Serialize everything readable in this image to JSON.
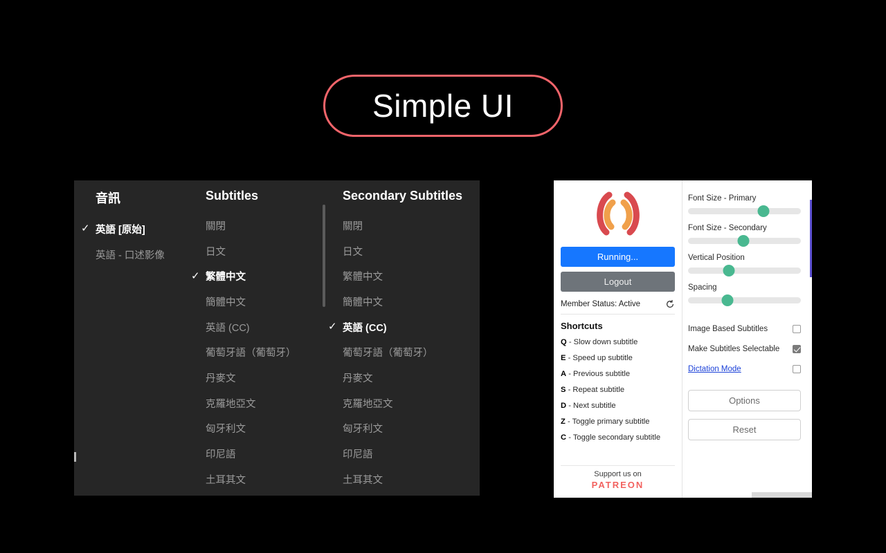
{
  "title_badge": {
    "text": "Simple UI",
    "border_color": "#f2646a"
  },
  "subtitle_panel": {
    "columns": [
      {
        "id": "audio",
        "header": "音訊",
        "options": [
          {
            "label": "英語 [原始]",
            "selected": true
          },
          {
            "label": "英語 - 口述影像",
            "selected": false
          }
        ]
      },
      {
        "id": "primary",
        "header": "Subtitles",
        "options": [
          {
            "label": "關閉",
            "selected": false
          },
          {
            "label": "日文",
            "selected": false
          },
          {
            "label": "繁體中文",
            "selected": true
          },
          {
            "label": "簡體中文",
            "selected": false
          },
          {
            "label": "英語 (CC)",
            "selected": false
          },
          {
            "label": "葡萄牙語（葡萄牙）",
            "selected": false
          },
          {
            "label": "丹麥文",
            "selected": false
          },
          {
            "label": "克羅地亞文",
            "selected": false
          },
          {
            "label": "匈牙利文",
            "selected": false
          },
          {
            "label": "印尼語",
            "selected": false
          },
          {
            "label": "土耳其文",
            "selected": false
          }
        ]
      },
      {
        "id": "secondary",
        "header": "Secondary Subtitles",
        "options": [
          {
            "label": "關閉",
            "selected": false
          },
          {
            "label": "日文",
            "selected": false
          },
          {
            "label": "繁體中文",
            "selected": false
          },
          {
            "label": "簡體中文",
            "selected": false
          },
          {
            "label": "英語 (CC)",
            "selected": true
          },
          {
            "label": "葡萄牙語（葡萄牙）",
            "selected": false
          },
          {
            "label": "丹麥文",
            "selected": false
          },
          {
            "label": "克羅地亞文",
            "selected": false
          },
          {
            "label": "匈牙利文",
            "selected": false
          },
          {
            "label": "印尼語",
            "selected": false
          },
          {
            "label": "土耳其文",
            "selected": false
          }
        ]
      }
    ],
    "check_glyph": "✓"
  },
  "extension_panel": {
    "logo": {
      "name": "language-reactor-brackets-logo",
      "outer_color": "#d94a4f",
      "inner_color": "#f0a04b"
    },
    "run_button": "Running...",
    "logout_button": "Logout",
    "member_status": "Member Status: Active",
    "refresh_icon": "refresh-icon",
    "shortcuts_title": "Shortcuts",
    "shortcuts": [
      {
        "key": "Q",
        "action": "- Slow down subtitle"
      },
      {
        "key": "E",
        "action": "- Speed up subtitle"
      },
      {
        "key": "A",
        "action": "- Previous subtitle"
      },
      {
        "key": "S",
        "action": "- Repeat subtitle"
      },
      {
        "key": "D",
        "action": "- Next subtitle"
      },
      {
        "key": "Z",
        "action": "- Toggle primary subtitle"
      },
      {
        "key": "C",
        "action": "- Toggle secondary subtitle"
      }
    ],
    "patreon_line": "Support us on",
    "patreon_logo": "PATREON",
    "sliders": [
      {
        "label": "Font Size - Primary",
        "percent": 67
      },
      {
        "label": "Font Size - Secondary",
        "percent": 49
      },
      {
        "label": "Vertical Position",
        "percent": 36
      },
      {
        "label": "Spacing",
        "percent": 35
      }
    ],
    "checkboxes": [
      {
        "label": "Image Based Subtitles",
        "checked": false,
        "is_link": false
      },
      {
        "label": "Make Subtitles Selectable",
        "checked": true,
        "is_link": false
      },
      {
        "label": "Dictation Mode",
        "checked": false,
        "is_link": true
      }
    ],
    "options_button": "Options",
    "reset_button": "Reset",
    "accent_colors": {
      "run": "#1677ff",
      "logout": "#6e747a",
      "slider_thumb": "#49b890",
      "patreon": "#f2625f",
      "link": "#1a40d8",
      "scrollbar": "#5b4fd0"
    }
  }
}
